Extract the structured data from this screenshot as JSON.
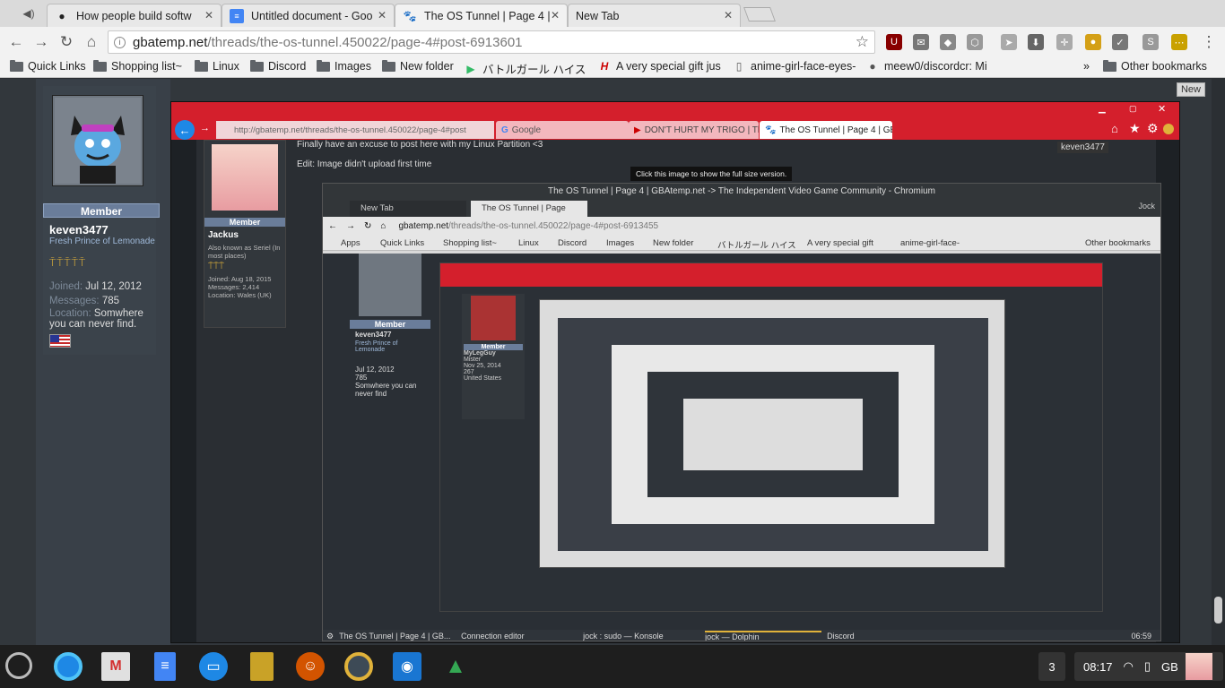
{
  "tabs": [
    {
      "title": "How people build softw",
      "icon": "github-icon"
    },
    {
      "title": "Untitled document - Goo",
      "icon": "docs-icon"
    },
    {
      "title": "The OS Tunnel | Page 4 |",
      "icon": "gbatemp-icon"
    },
    {
      "title": "New Tab",
      "icon": ""
    }
  ],
  "url": {
    "host": "gbatemp.net",
    "path": "/threads/the-os-tunnel.450022/page-4#post-6913601"
  },
  "bookmarks": [
    "Quick Links",
    "Shopping list~",
    "Linux",
    "Discord",
    "Images",
    "New folder",
    "バトルガール ハイス",
    "A very special gift jus",
    "anime-girl-face-eyes-",
    "meew0/discordcr: Mi",
    "Other bookmarks"
  ],
  "new_label": "New",
  "profile": {
    "rank": "Member",
    "name": "keven3477",
    "title": "Fresh Prince of Lemonade",
    "joined_label": "Joined:",
    "joined": "Jul 12, 2012",
    "messages_label": "Messages:",
    "messages": "785",
    "location_label": "Location:",
    "location": "Somwhere you can never find."
  },
  "screenshot": {
    "tabs": [
      "Google",
      "DON'T HURT MY TRIGO | The L",
      "The OS Tunnel | Page 4 | GB"
    ],
    "url": "http://gbatemp.net/threads/the-os-tunnel.450022/page-4#post",
    "user": "keven3477",
    "post_text": "Finally have an excuse to post here with my Linux Partition <3",
    "edit_text": "Edit: Image didn't upload first time",
    "tooltip": "Click this image to show the full size version.",
    "poster": {
      "rank": "Member",
      "name": "Jackus",
      "title": "Also known as Seriel (In most places)",
      "joined": "Joined: Aug 18, 2015",
      "messages": "Messages: 2,414",
      "location": "Location: Wales (UK)"
    },
    "window_title": "The OS Tunnel | Page 4 | GBAtemp.net -> The Independent Video Game Community - Chromium",
    "window_user": "Jock",
    "inner_tabs": [
      "New Tab",
      "The OS Tunnel | Page"
    ],
    "inner_url_host": "gbatemp.net",
    "inner_url_path": "/threads/the-os-tunnel.450022/page-4#post-6913455",
    "inner_bookmarks": [
      "Apps",
      "Quick Links",
      "Shopping list~",
      "Linux",
      "Discord",
      "Images",
      "New folder",
      "バトルガール ハイス",
      "A very special gift",
      "anime-girl-face-",
      "Other bookmarks"
    ],
    "inner_profile": {
      "rank": "Member",
      "name": "keven3477",
      "title": "Fresh Prince of Lemonade",
      "joined": "Jul 12, 2012",
      "messages": "785",
      "location": "Somwhere you can never find"
    },
    "inner_poster": {
      "rank": "Member",
      "name": "MyLegGuy",
      "title": "Mister",
      "joined": "Nov 25, 2014",
      "messages": "267",
      "location": "United States"
    },
    "taskbar": [
      "The OS Tunnel | Page 4 | GB...",
      "Connection editor",
      "jock : sudo — Konsole",
      "jock — Dolphin",
      "Discord"
    ],
    "taskbar_time": "06:59"
  },
  "shelf": {
    "badge": "3",
    "time": "08:17",
    "lang": "GB"
  }
}
